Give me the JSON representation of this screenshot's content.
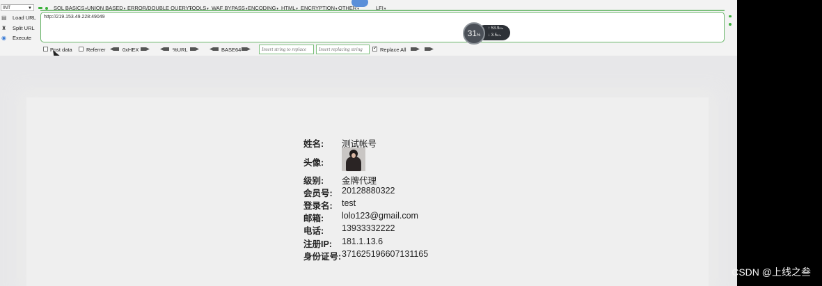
{
  "hackbar": {
    "mode_select": "INT",
    "menu": [
      "SQL BASICS",
      "UNION BASED",
      "ERROR/DOUBLE QUERY",
      "TOOLS",
      "WAF BYPASS",
      "ENCODING",
      "HTML",
      "ENCRYPTION",
      "OTHER",
      "LFI"
    ],
    "side_buttons": {
      "load": "Load URL",
      "split": "Split URL",
      "execute": "Execute"
    },
    "url": "http://219.153.49.228:49049",
    "options": {
      "post_data": "Post data",
      "referrer": "Referrer",
      "hex": "0xHEX",
      "url_enc": "%URL",
      "base64": "BASE64",
      "replace_placeholder": "Insert string to replace",
      "replacing_placeholder": "Insert replacing string",
      "replace_all": "Replace All"
    }
  },
  "speed_widget": {
    "percent": "31",
    "unit": "%",
    "upload": "53.9",
    "download": "3.5",
    "rate_unit": "K/s"
  },
  "profile": {
    "fields": [
      {
        "label": "姓名:",
        "value": "测试帐号"
      },
      {
        "label": "头像:",
        "value": ""
      },
      {
        "label": "级别:",
        "value": "金牌代理"
      },
      {
        "label": "会员号:",
        "value": "20128880322"
      },
      {
        "label": "登录名:",
        "value": "test"
      },
      {
        "label": "邮箱:",
        "value": "lolo123@gmail.com"
      },
      {
        "label": "电话:",
        "value": "13933332222"
      },
      {
        "label": "注册IP:",
        "value": "181.1.13.6"
      },
      {
        "label": "身份证号:",
        "value": "371625196607131165"
      }
    ]
  },
  "watermark": "CSDN @上线之叁"
}
